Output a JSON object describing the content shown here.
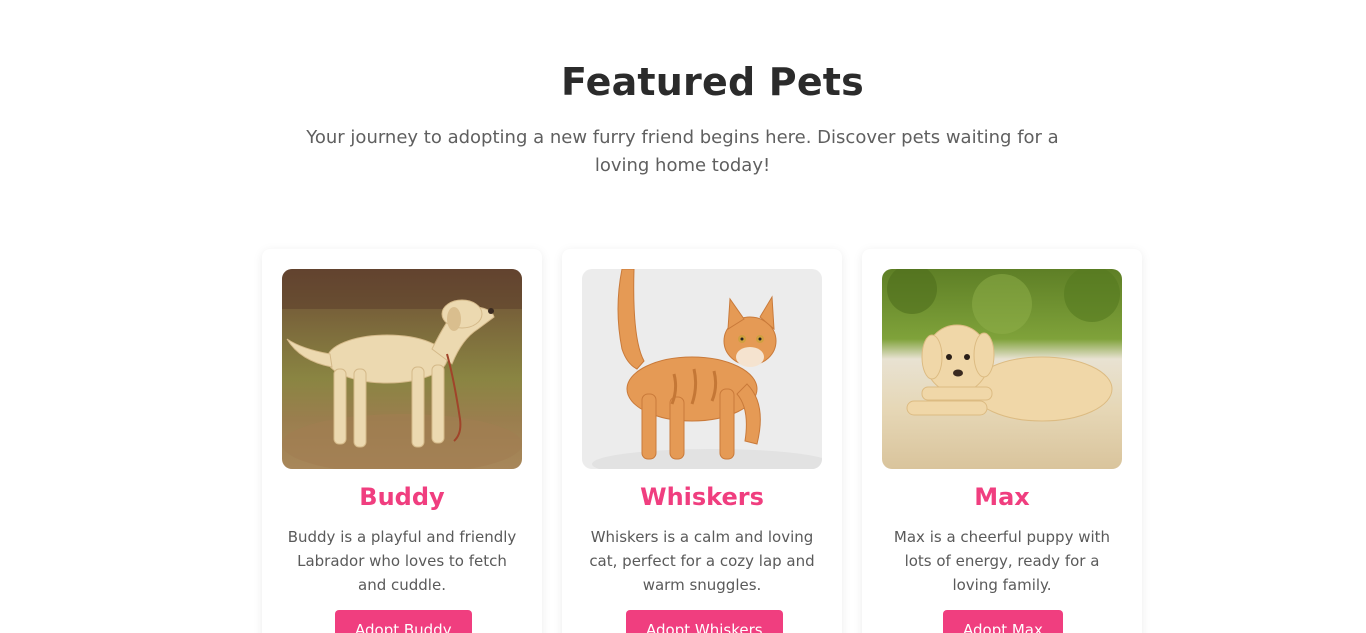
{
  "header": {
    "title": "Featured Pets",
    "subtitle": "Your journey to adopting a new furry friend begins here. Discover pets waiting for a loving home today!"
  },
  "accent_color": "#f03e7f",
  "pets": [
    {
      "name": "Buddy",
      "description": "Buddy is a playful and friendly Labrador who loves to fetch and cuddle.",
      "button_label": "Adopt Buddy"
    },
    {
      "name": "Whiskers",
      "description": "Whiskers is a calm and loving cat, perfect for a cozy lap and warm snuggles.",
      "button_label": "Adopt Whiskers"
    },
    {
      "name": "Max",
      "description": "Max is a cheerful puppy with lots of energy, ready for a loving family.",
      "button_label": "Adopt Max"
    }
  ]
}
